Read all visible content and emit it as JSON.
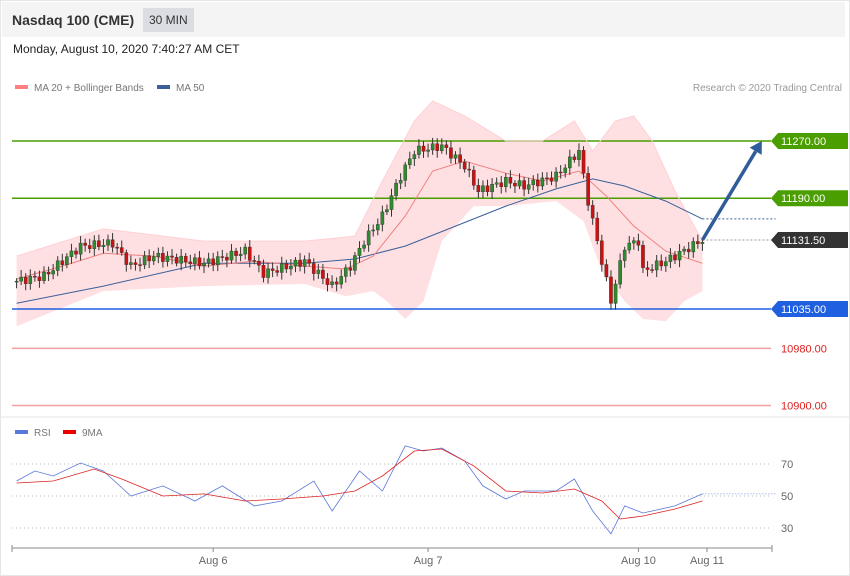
{
  "header": {
    "title": "Nasdaq 100 (CME)",
    "timeframe": "30 MIN",
    "datetime": "Monday, August 10, 2020 7:40:27 AM CET"
  },
  "legend": {
    "ma20": "MA 20 + Bollinger Bands",
    "ma50": "MA 50",
    "credit": "Research © 2020 Trading Central",
    "rsi": "RSI",
    "rsi_ma": "9MA"
  },
  "colors": {
    "ma20": "#f08080",
    "ma50": "#3a5f9a",
    "band": "#ffe0e2",
    "resistance": "#4a9e00",
    "support": "#1f5fe0",
    "support2": "#e02020",
    "current": "#333333",
    "up": "#2e8b2e",
    "down": "#cc1111",
    "arrow": "#2f5d99",
    "rsi": "#5a77d9",
    "rsi_ma": "#e02020"
  },
  "chart_data": [
    {
      "type": "line",
      "title": "Nasdaq 100 (CME) 30 MIN",
      "xunit": "bar index",
      "x_ticks": [
        {
          "label": "Aug 6",
          "x": 43
        },
        {
          "label": "Aug 7",
          "x": 90
        },
        {
          "label": "Aug 10",
          "x": 136
        },
        {
          "label": "Aug 11",
          "x": 151
        }
      ],
      "xlim": [
        -1,
        165
      ],
      "ylim": [
        10880,
        11340
      ],
      "levels": [
        {
          "label": "11270.00",
          "value": 11270,
          "kind": "resistance"
        },
        {
          "label": "11190.00",
          "value": 11190,
          "kind": "resistance"
        },
        {
          "label": "11131.50",
          "value": 11131.5,
          "kind": "current"
        },
        {
          "label": "11035.00",
          "value": 11035,
          "kind": "support"
        },
        {
          "label": "10980.00",
          "value": 10980,
          "kind": "support2"
        },
        {
          "label": "10900.00",
          "value": 10900,
          "kind": "support2"
        }
      ],
      "price_path": [
        [
          0,
          11074
        ],
        [
          6,
          11081
        ],
        [
          14,
          11123
        ],
        [
          21,
          11127
        ],
        [
          25,
          11095
        ],
        [
          30,
          11109
        ],
        [
          41,
          11099
        ],
        [
          50,
          11116
        ],
        [
          54,
          11085
        ],
        [
          63,
          11102
        ],
        [
          69,
          11067
        ],
        [
          73,
          11095
        ],
        [
          76,
          11130
        ],
        [
          80,
          11165
        ],
        [
          84,
          11221
        ],
        [
          87,
          11256
        ],
        [
          93,
          11263
        ],
        [
          98,
          11235
        ],
        [
          101,
          11200
        ],
        [
          107,
          11214
        ],
        [
          111,
          11207
        ],
        [
          118,
          11221
        ],
        [
          123,
          11256
        ],
        [
          125,
          11186
        ],
        [
          128,
          11102
        ],
        [
          130,
          11046
        ],
        [
          133,
          11123
        ],
        [
          136,
          11130
        ],
        [
          137,
          11088
        ],
        [
          142,
          11102
        ],
        [
          150,
          11131.5
        ]
      ],
      "ma50": [
        [
          0,
          11043
        ],
        [
          19,
          11067
        ],
        [
          41,
          11099
        ],
        [
          63,
          11099
        ],
        [
          74,
          11105
        ],
        [
          85,
          11123
        ],
        [
          96,
          11151
        ],
        [
          107,
          11179
        ],
        [
          118,
          11203
        ],
        [
          126,
          11217
        ],
        [
          133,
          11207
        ],
        [
          142,
          11186
        ],
        [
          150,
          11161
        ],
        [
          166,
          11161
        ]
      ],
      "ma20": [
        [
          0,
          11077
        ],
        [
          10,
          11095
        ],
        [
          19,
          11113
        ],
        [
          30,
          11109
        ],
        [
          41,
          11095
        ],
        [
          52,
          11102
        ],
        [
          63,
          11095
        ],
        [
          72,
          11091
        ],
        [
          78,
          11109
        ],
        [
          85,
          11165
        ],
        [
          91,
          11228
        ],
        [
          98,
          11242
        ],
        [
          107,
          11225
        ],
        [
          115,
          11214
        ],
        [
          123,
          11228
        ],
        [
          129,
          11193
        ],
        [
          135,
          11151
        ],
        [
          142,
          11116
        ],
        [
          150,
          11099
        ]
      ],
      "bb_upper": [
        [
          0,
          11109
        ],
        [
          19,
          11147
        ],
        [
          41,
          11130
        ],
        [
          63,
          11130
        ],
        [
          74,
          11137
        ],
        [
          80,
          11214
        ],
        [
          87,
          11298
        ],
        [
          91,
          11326
        ],
        [
          98,
          11305
        ],
        [
          107,
          11270
        ],
        [
          115,
          11270
        ],
        [
          122,
          11298
        ],
        [
          126,
          11256
        ],
        [
          131,
          11298
        ],
        [
          135,
          11305
        ],
        [
          139,
          11270
        ],
        [
          144,
          11200
        ],
        [
          150,
          11130
        ]
      ],
      "bb_lower": [
        [
          0,
          11011
        ],
        [
          19,
          11060
        ],
        [
          41,
          11067
        ],
        [
          63,
          11070
        ],
        [
          72,
          11053
        ],
        [
          78,
          11060
        ],
        [
          81,
          11046
        ],
        [
          85,
          11021
        ],
        [
          89,
          11046
        ],
        [
          93,
          11130
        ],
        [
          100,
          11179
        ],
        [
          107,
          11179
        ],
        [
          118,
          11186
        ],
        [
          124,
          11158
        ],
        [
          128,
          11088
        ],
        [
          133,
          11046
        ],
        [
          137,
          11021
        ],
        [
          142,
          11018
        ],
        [
          146,
          11046
        ],
        [
          150,
          11060
        ]
      ],
      "forecast_target": {
        "from": [
          150,
          11131.5
        ],
        "to": [
          163,
          11270
        ]
      }
    },
    {
      "type": "line",
      "title": "RSI",
      "ylim": [
        0,
        100
      ],
      "y_ticks": [
        70,
        50,
        30
      ],
      "rsi": [
        [
          0,
          59.4
        ],
        [
          4,
          65.6
        ],
        [
          8,
          62.5
        ],
        [
          14,
          70.6
        ],
        [
          19,
          65.6
        ],
        [
          25,
          50
        ],
        [
          32,
          56.3
        ],
        [
          39,
          46.9
        ],
        [
          45,
          56.3
        ],
        [
          52,
          43.8
        ],
        [
          58,
          46.9
        ],
        [
          65,
          59.4
        ],
        [
          69,
          40.6
        ],
        [
          75,
          65.6
        ],
        [
          80,
          53.1
        ],
        [
          85,
          81.3
        ],
        [
          89,
          78.1
        ],
        [
          93,
          80
        ],
        [
          98,
          71.9
        ],
        [
          102,
          56.3
        ],
        [
          107,
          48.1
        ],
        [
          111,
          53.1
        ],
        [
          118,
          53.1
        ],
        [
          122,
          60.6
        ],
        [
          126,
          40.6
        ],
        [
          130,
          26.3
        ],
        [
          133,
          43.8
        ],
        [
          137,
          39.4
        ],
        [
          144,
          43.8
        ],
        [
          150,
          51.3
        ],
        [
          166,
          51.3
        ]
      ],
      "rsi_ma": [
        [
          0,
          58.1
        ],
        [
          8,
          59.4
        ],
        [
          17,
          66.9
        ],
        [
          23,
          60.6
        ],
        [
          32,
          50
        ],
        [
          41,
          51.3
        ],
        [
          50,
          46.9
        ],
        [
          58,
          48.1
        ],
        [
          67,
          50
        ],
        [
          74,
          53.1
        ],
        [
          80,
          62.5
        ],
        [
          87,
          78.1
        ],
        [
          93,
          79.4
        ],
        [
          100,
          68.8
        ],
        [
          107,
          53.1
        ],
        [
          115,
          51.9
        ],
        [
          122,
          54.4
        ],
        [
          128,
          46.9
        ],
        [
          132,
          35.6
        ],
        [
          137,
          37.5
        ],
        [
          144,
          41.9
        ],
        [
          150,
          46.9
        ]
      ]
    }
  ]
}
